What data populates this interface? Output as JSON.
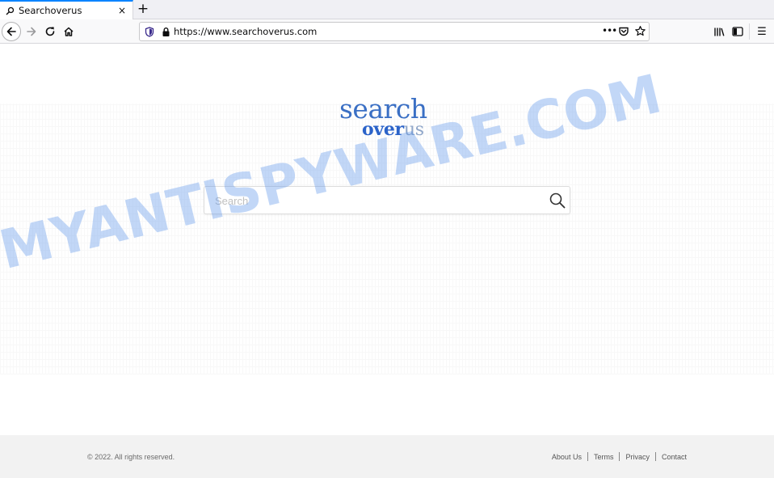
{
  "browser": {
    "tab_title": "Searchoverus",
    "tab_close_glyph": "×",
    "new_tab_glyph": "+",
    "url": "https://www.searchoverus.com",
    "page_actions_glyph": "•••",
    "menu_glyph": "☰",
    "icons": {
      "tab_favicon": "search-icon",
      "back": "back-arrow-icon",
      "forward": "forward-arrow-icon",
      "reload": "reload-icon",
      "home": "home-icon",
      "tracking": "tracking-protection-shield-icon",
      "lock": "lock-icon",
      "pocket": "pocket-icon",
      "bookmark": "bookmark-star-icon",
      "library": "library-icon",
      "sidebar": "sidebar-icon"
    }
  },
  "page": {
    "logo": {
      "line1": "search",
      "line2_part1": "over",
      "line2_part2": "us"
    },
    "search": {
      "placeholder": "Search",
      "value": "",
      "button_icon": "magnifier-icon"
    },
    "watermark": "MYANTISPYWARE.COM",
    "footer": {
      "copyright": "© 2022. All rights reserved.",
      "links": [
        "About Us",
        "Terms",
        "Privacy",
        "Contact"
      ]
    }
  },
  "colors": {
    "logo_blue": "#3a6fc4",
    "logo_light": "#8fa6c9",
    "tab_accent": "#0a84ff",
    "footer_bg": "#f2f2f2",
    "watermark": "#5f96eb"
  }
}
